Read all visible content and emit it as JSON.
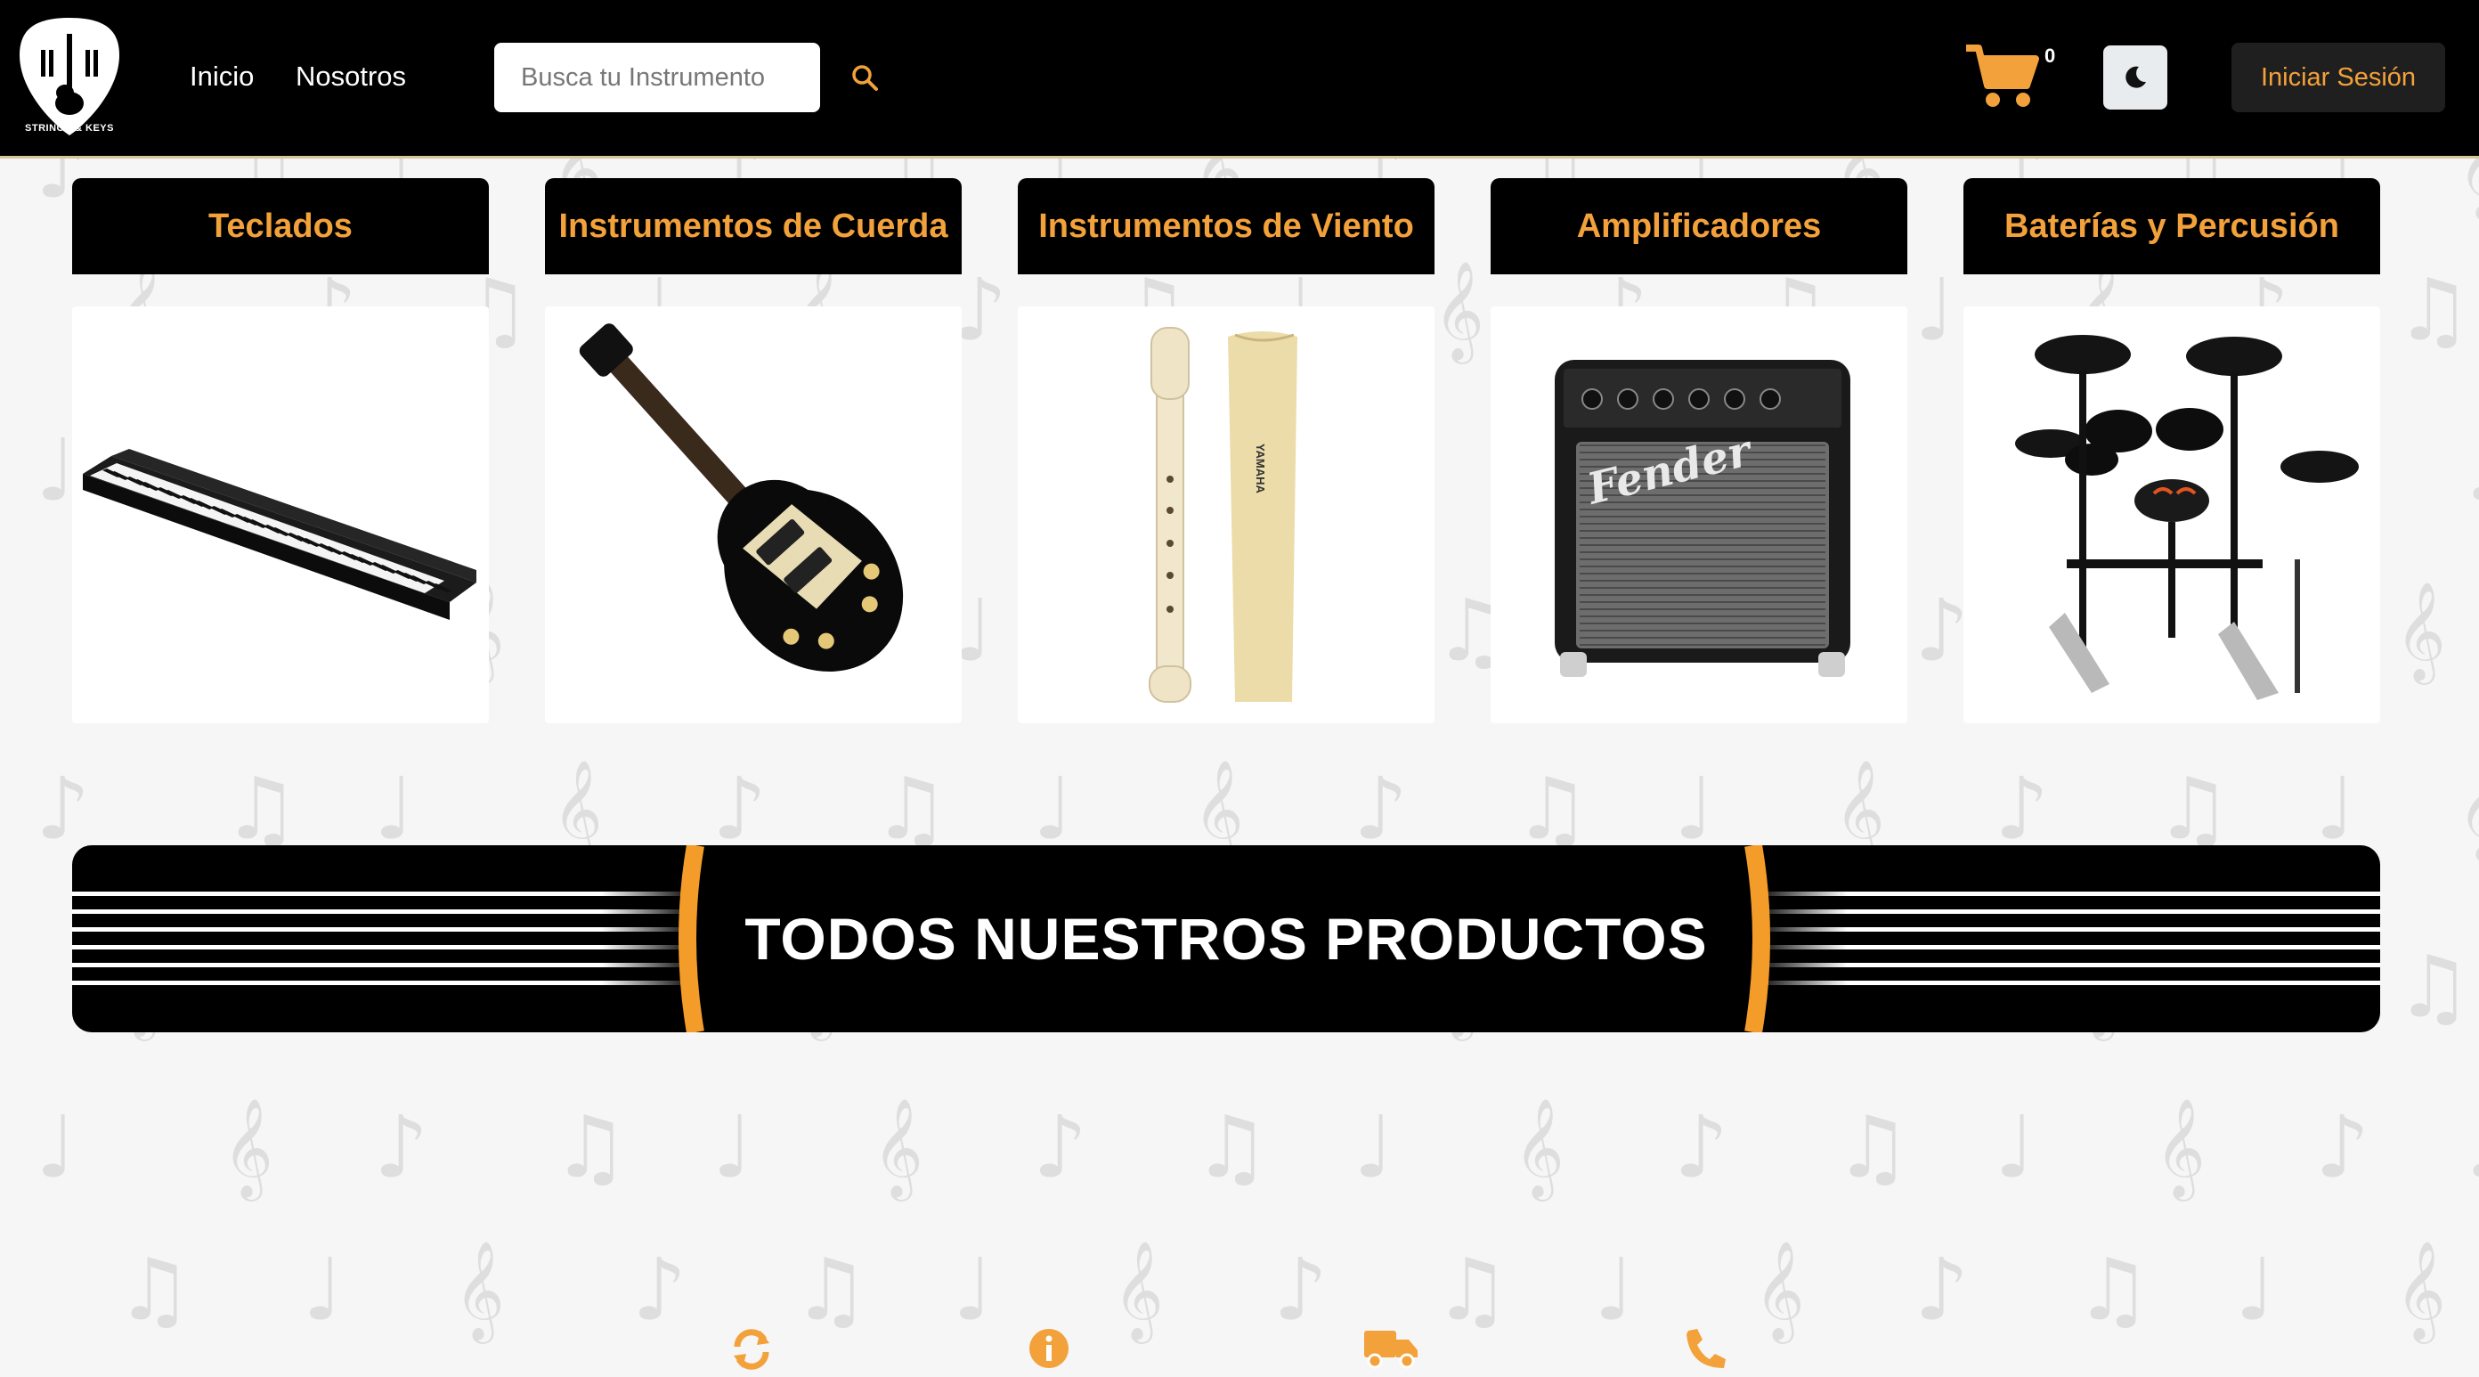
{
  "brand": {
    "name": "STRINGS & KEYS"
  },
  "nav": {
    "home": "Inicio",
    "about": "Nosotros"
  },
  "search": {
    "placeholder": "Busca tu Instrumento",
    "value": ""
  },
  "cart": {
    "count": "0"
  },
  "login": {
    "label": "Iniciar Sesión"
  },
  "categories": [
    {
      "title": "Teclados",
      "image": "keyboard-piano"
    },
    {
      "title": "Instrumentos de Cuerda",
      "image": "electric-guitar"
    },
    {
      "title": "Instrumentos de Viento",
      "image": "recorder-flute"
    },
    {
      "title": "Amplificadores",
      "image": "guitar-amplifier"
    },
    {
      "title": "Baterías y Percusión",
      "image": "electronic-drum-kit"
    }
  ],
  "amp_brand": "Fender",
  "recorder_brand": "YAMAHA",
  "banner": {
    "title": "TODOS NUESTROS PRODUCTOS"
  },
  "footer_icons": [
    "refresh-icon",
    "info-icon",
    "truck-icon",
    "phone-icon"
  ],
  "colors": {
    "accent": "#f3a13a",
    "header_bg": "#000000",
    "page_bg": "#f6f6f6"
  }
}
